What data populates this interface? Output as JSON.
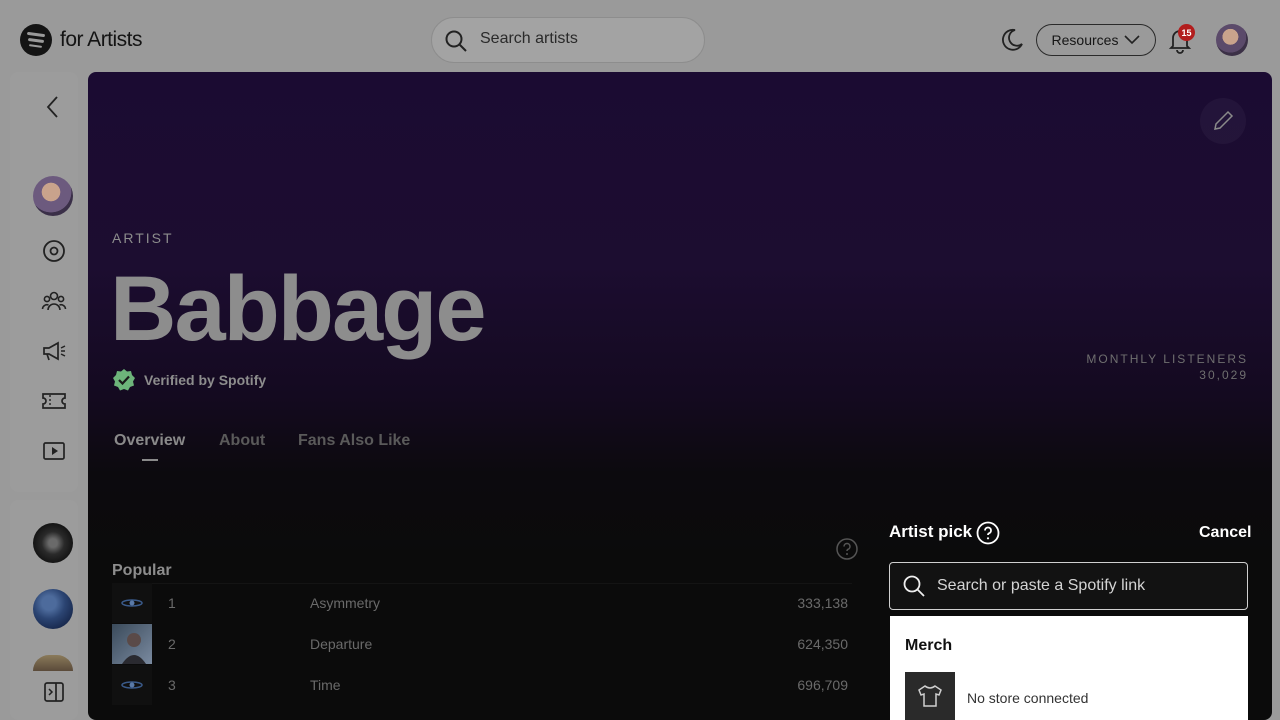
{
  "header": {
    "logo_text": "for Artists",
    "search_placeholder": "Search artists",
    "resources_label": "Resources",
    "notification_count": "15"
  },
  "artist": {
    "tag": "ARTIST",
    "name": "Babbage",
    "verified_label": "Verified by Spotify",
    "monthly_listeners_label": "MONTHLY LISTENERS",
    "monthly_listeners_value": "30,029"
  },
  "tabs": [
    "Overview",
    "About",
    "Fans Also Like"
  ],
  "popular": {
    "heading": "Popular",
    "rows": [
      {
        "num": "1",
        "title": "Asymmetry",
        "plays": "333,138"
      },
      {
        "num": "2",
        "title": "Departure",
        "plays": "624,350"
      },
      {
        "num": "3",
        "title": "Time",
        "plays": "696,709"
      }
    ]
  },
  "artist_pick": {
    "title": "Artist pick",
    "cancel_label": "Cancel",
    "search_placeholder": "Search or paste a Spotify link",
    "dropdown": {
      "section_heading": "Merch",
      "item_text": "No store connected"
    }
  },
  "colors": {
    "accent_green": "#6db47a",
    "badge_red": "#b21d1d",
    "hero_purple": "#1c0d30"
  }
}
